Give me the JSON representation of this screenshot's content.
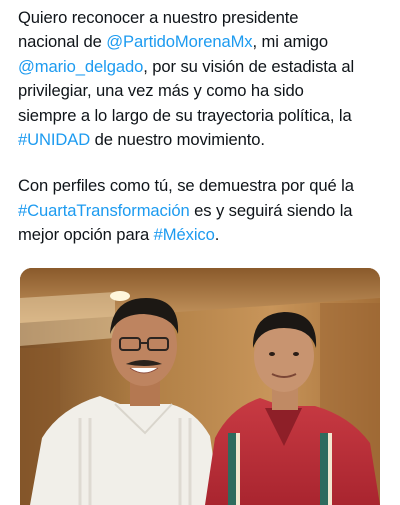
{
  "tweet": {
    "paragraph1": {
      "line1": "Quiero reconocer a nuestro presidente",
      "line2_prefix": "nacional de ",
      "mention1": "@PartidoMorenaMx",
      "line2_suffix": ", mi amigo",
      "mention2": "@mario_delgado",
      "line3_suffix": ", por su visión de estadista al",
      "line4": "privilegiar, una vez más y como ha sido",
      "line5": "siempre a lo largo de su trayectoria política, la",
      "hashtag1": "#UNIDAD",
      "line6_suffix": " de nuestro movimiento."
    },
    "paragraph2": {
      "line1": "Con perfiles como tú, se demuestra por qué la",
      "hashtag2": "#CuartaTransformación",
      "line2_suffix": " es y seguirá siendo la",
      "line3_prefix": "mejor opción para ",
      "hashtag3": "#México",
      "line3_suffix": "."
    }
  },
  "colors": {
    "text": "#0f1419",
    "link": "#1d9bf0",
    "background": "#ffffff"
  }
}
